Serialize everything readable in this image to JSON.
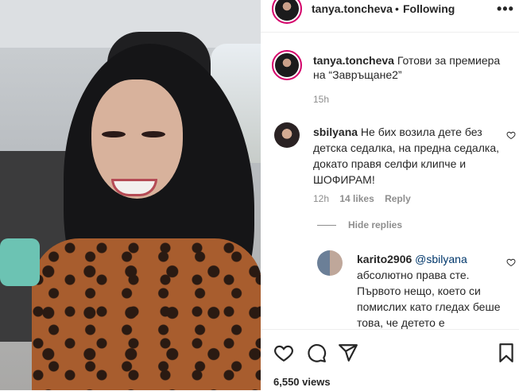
{
  "header": {
    "username": "tanya.toncheva",
    "separator": "•",
    "follow_status": "Following",
    "more_label": "•••"
  },
  "caption": {
    "username": "tanya.toncheva",
    "text": "Готови за премиера на “Завръщане2”",
    "time": "15h"
  },
  "comment": {
    "username": "sbilyana",
    "text": "Не бих возила дете без детска седалка, на предна седалка, докато правя селфи клипче и ШОФИРАМ!",
    "time": "12h",
    "likes": "14 likes",
    "reply_label": "Reply"
  },
  "hide_replies_label": "Hide replies",
  "reply": {
    "username": "karito2906",
    "mention": "@sbilyana",
    "text": "абсолютно права сте. Първото нещо, което си помислих като гледах беше това, че детето е"
  },
  "actions": {
    "icons": [
      "heart-icon",
      "comment-icon",
      "share-icon",
      "bookmark-icon"
    ]
  },
  "views": "6,550 views"
}
